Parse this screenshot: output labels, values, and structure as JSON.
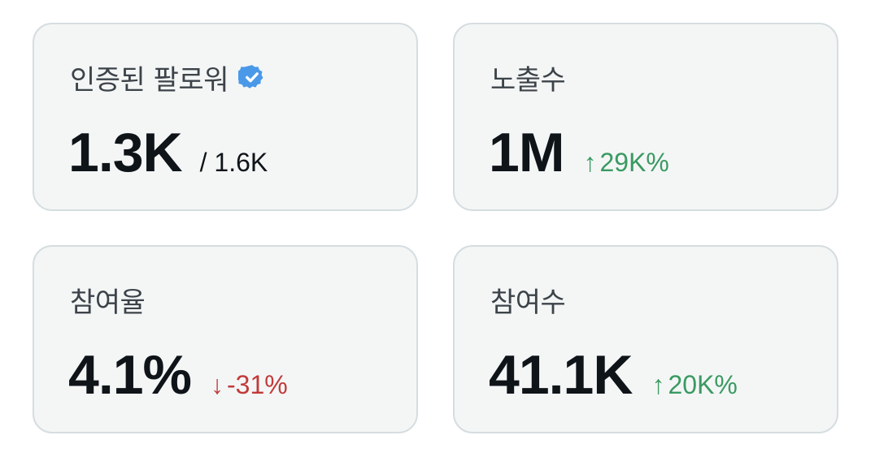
{
  "cards": [
    {
      "label": "인증된 팔로워",
      "value": "1.3K",
      "secondary": "/ 1.6K",
      "icon": "verified-badge-icon"
    },
    {
      "label": "노출수",
      "value": "1M",
      "delta": {
        "arrow": "↑",
        "text": "29K%",
        "direction": "up",
        "color": "#3a9a62"
      }
    },
    {
      "label": "참여율",
      "value": "4.1%",
      "delta": {
        "arrow": "↓",
        "text": "-31%",
        "direction": "down",
        "color": "#c23a3a"
      }
    },
    {
      "label": "참여수",
      "value": "41.1K",
      "delta": {
        "arrow": "↑",
        "text": "20K%",
        "direction": "up",
        "color": "#3a9a62"
      }
    }
  ],
  "colors": {
    "card_background": "#f4f6f6",
    "card_border": "#d6dde0",
    "verified_blue": "#4a99e9",
    "text_primary": "#0f1419",
    "text_label": "#3c4349"
  }
}
